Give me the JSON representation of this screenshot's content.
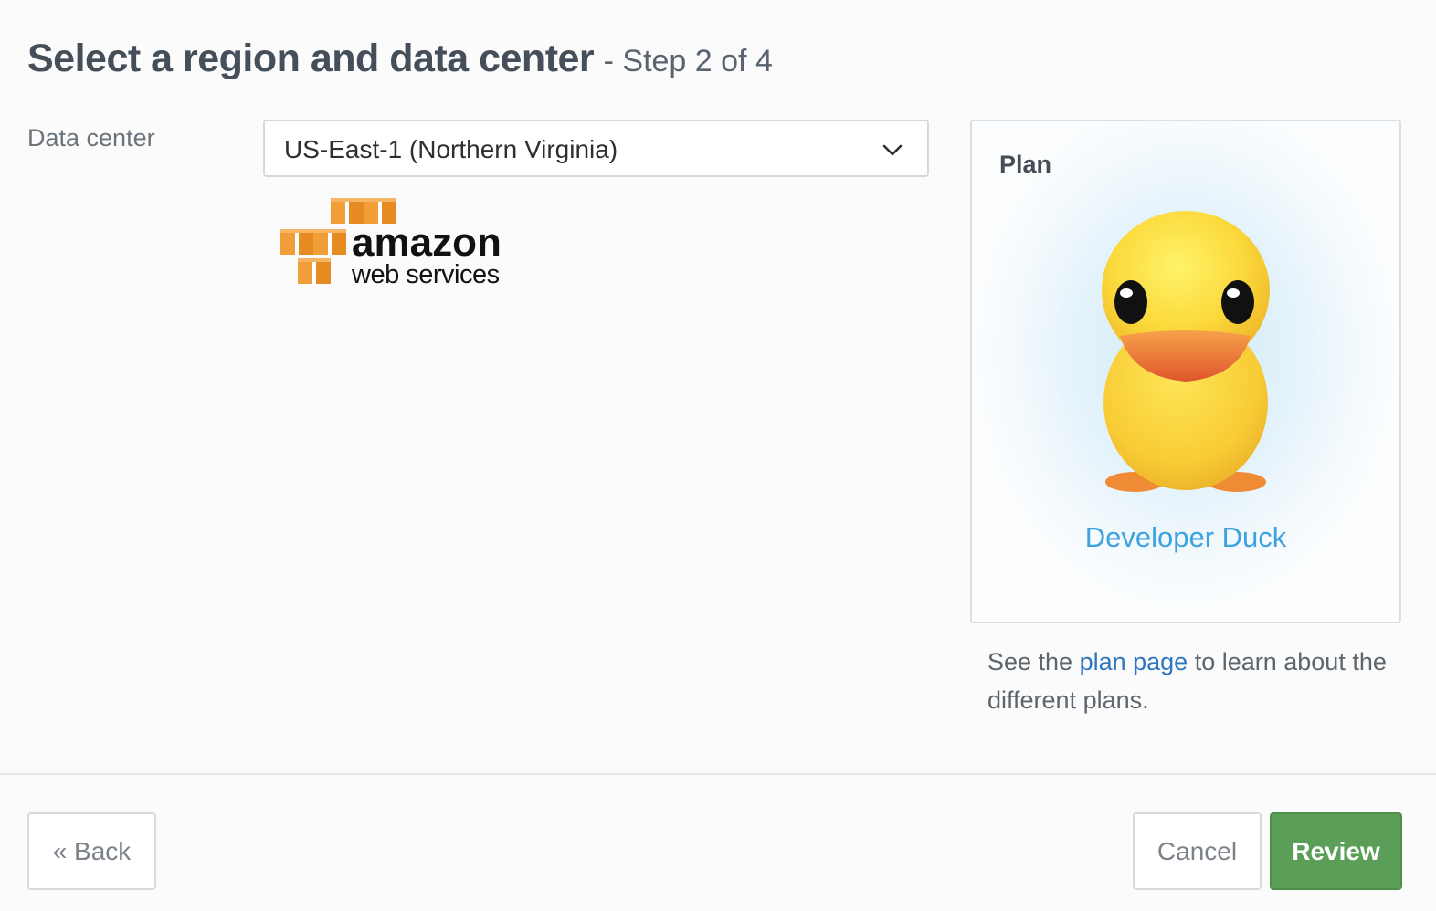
{
  "header": {
    "title": "Select a region and data center",
    "step": "- Step 2 of 4"
  },
  "data_center": {
    "label": "Data center",
    "selected": "US-East-1 (Northern Virginia)",
    "provider_logo": {
      "line1": "amazon",
      "line2": "web services",
      "color": "#f19e39"
    }
  },
  "plan": {
    "label": "Plan",
    "name": "Developer Duck",
    "note_prefix": "See the ",
    "note_link": "plan page",
    "note_suffix": " to learn about the different plans."
  },
  "footer": {
    "back_label": "« Back",
    "cancel_label": "Cancel",
    "review_label": "Review"
  },
  "colors": {
    "accent_link": "#2f76bf",
    "plan_name": "#3ea1e0",
    "review_button": "#5a9e57"
  }
}
